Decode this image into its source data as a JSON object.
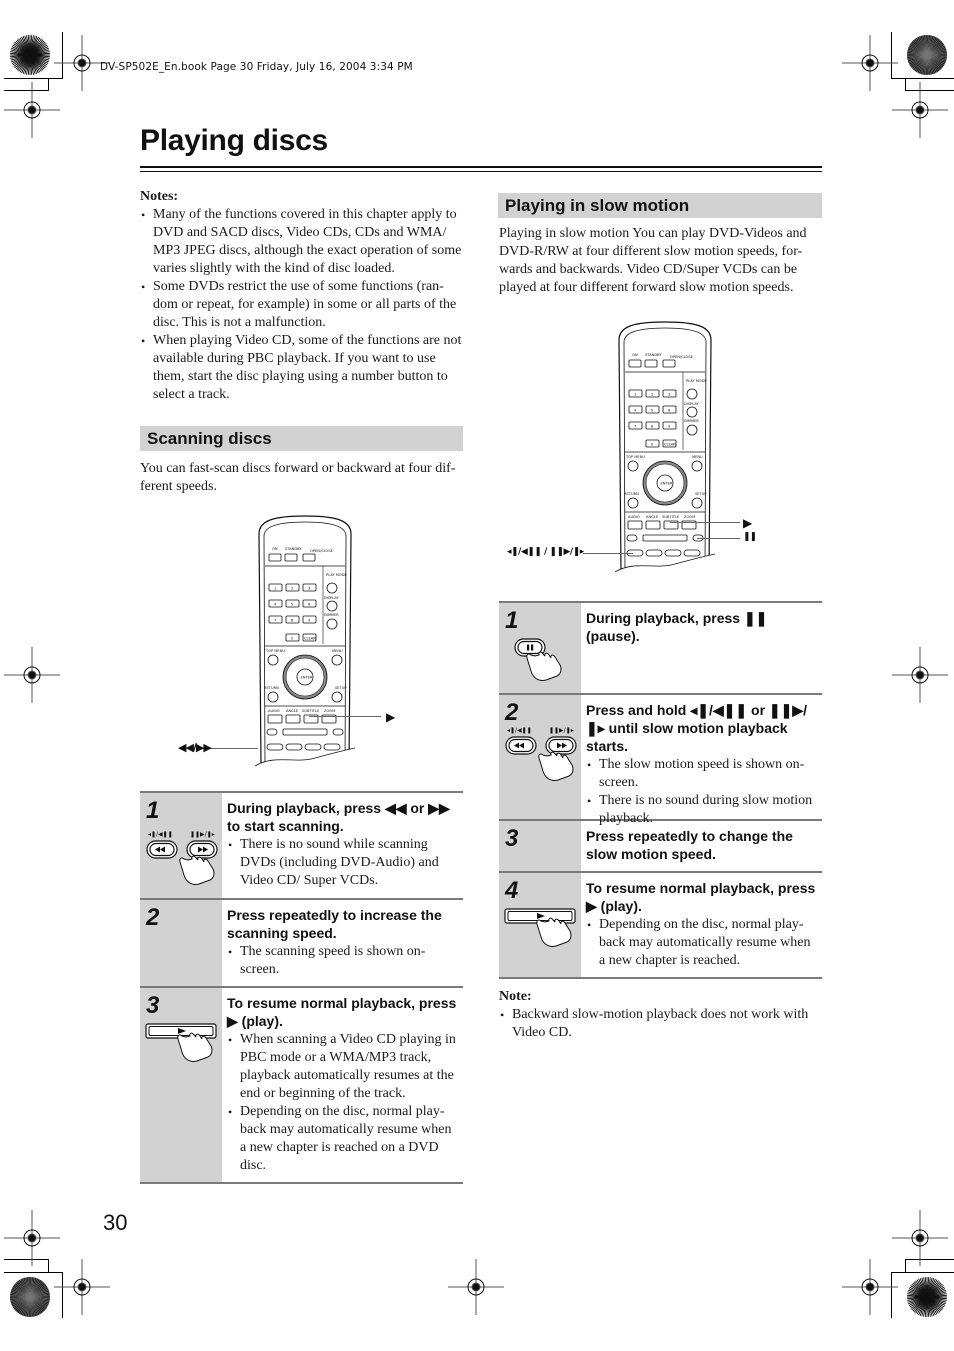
{
  "print_header": "DV-SP502E_En.book  Page 30  Friday, July 16, 2004  3:34 PM",
  "page_title": "Playing discs",
  "notes": {
    "heading": "Notes:",
    "items": [
      "Many of the functions covered in this chapter apply to DVD and SACD discs, Video CDs, CDs and WMA/ MP3 JPEG discs, although the exact operation of some varies slightly with the kind of disc loaded.",
      "Some DVDs restrict the use of some functions (ran-dom or repeat, for example) in some or all parts of the disc. This is not a malfunction.",
      "When playing Video CD, some of the functions are not available during PBC playback. If you want to use them, start the disc playing using a number button to select a track."
    ]
  },
  "scanning": {
    "heading": "Scanning discs",
    "intro": "You can fast-scan discs forward or backward at four dif-ferent speeds.",
    "callouts": {
      "play": "▶",
      "scan": "◀◀/▶▶"
    },
    "steps": [
      {
        "number": "1",
        "title": "During playback, press ◀◀ or ▶▶ to start scanning.",
        "bullets": [
          "There is no sound while scanning DVDs (including DVD-Audio) and Video CD/ Super VCDs."
        ]
      },
      {
        "number": "2",
        "title": "Press repeatedly to increase the scanning speed.",
        "bullets": [
          "The scanning speed is shown on-screen."
        ]
      },
      {
        "number": "3",
        "title": "To resume normal playback, press ▶ (play).",
        "bullets": [
          "When scanning a Video CD playing in PBC mode or a WMA/MP3 track, playback automatically resumes at the end or beginning of the track.",
          "Depending on the disc, normal play-back may automatically resume when a new chapter is reached on a DVD disc."
        ]
      }
    ]
  },
  "slow_motion": {
    "heading": "Playing in slow motion",
    "intro": "Playing in slow motion You can play DVD-Videos and DVD-R/RW at four different slow motion speeds, for-wards and backwards. Video CD/Super VCDs can be played at four different forward slow motion speeds.",
    "callouts": {
      "play": "▶",
      "pause": "❚❚",
      "slow": "◂❚/◀❚❚ / ❚❚▶/❚▸"
    },
    "steps": [
      {
        "number": "1",
        "title": "During playback, press ❚❚ (pause).",
        "bullets": []
      },
      {
        "number": "2",
        "title": "Press and hold ◂❚/◀❚❚ or ❚❚▶/❚▸ until slow motion playback starts.",
        "bullets": [
          "The slow motion speed is shown on-screen.",
          "There is no sound during slow motion playback."
        ]
      },
      {
        "number": "3",
        "title": "Press repeatedly to change the slow motion speed.",
        "bullets": []
      },
      {
        "number": "4",
        "title": "To resume normal playback, press ▶ (play).",
        "bullets": [
          "Depending on the disc, normal play-back may automatically resume when a new chapter is reached."
        ]
      }
    ],
    "note": {
      "heading": "Note:",
      "items": [
        "Backward slow-motion playback does not work with Video CD."
      ]
    }
  },
  "remote": {
    "labels": [
      "ON",
      "STANDBY",
      "OPEN/CLOSE",
      "PLAY MODE",
      "DISPLAY",
      "DIMMER",
      "TOP MENU",
      "MENU",
      "RETURN",
      "SETUP",
      "ENTER",
      "AUDIO",
      "ANGLE",
      "SUBTITLE",
      "ZOOM",
      "CLEAR"
    ],
    "digits": [
      "1",
      "2",
      "3",
      "4",
      "5",
      "6",
      "7",
      "8",
      "9",
      "0"
    ]
  },
  "page_number": "30"
}
